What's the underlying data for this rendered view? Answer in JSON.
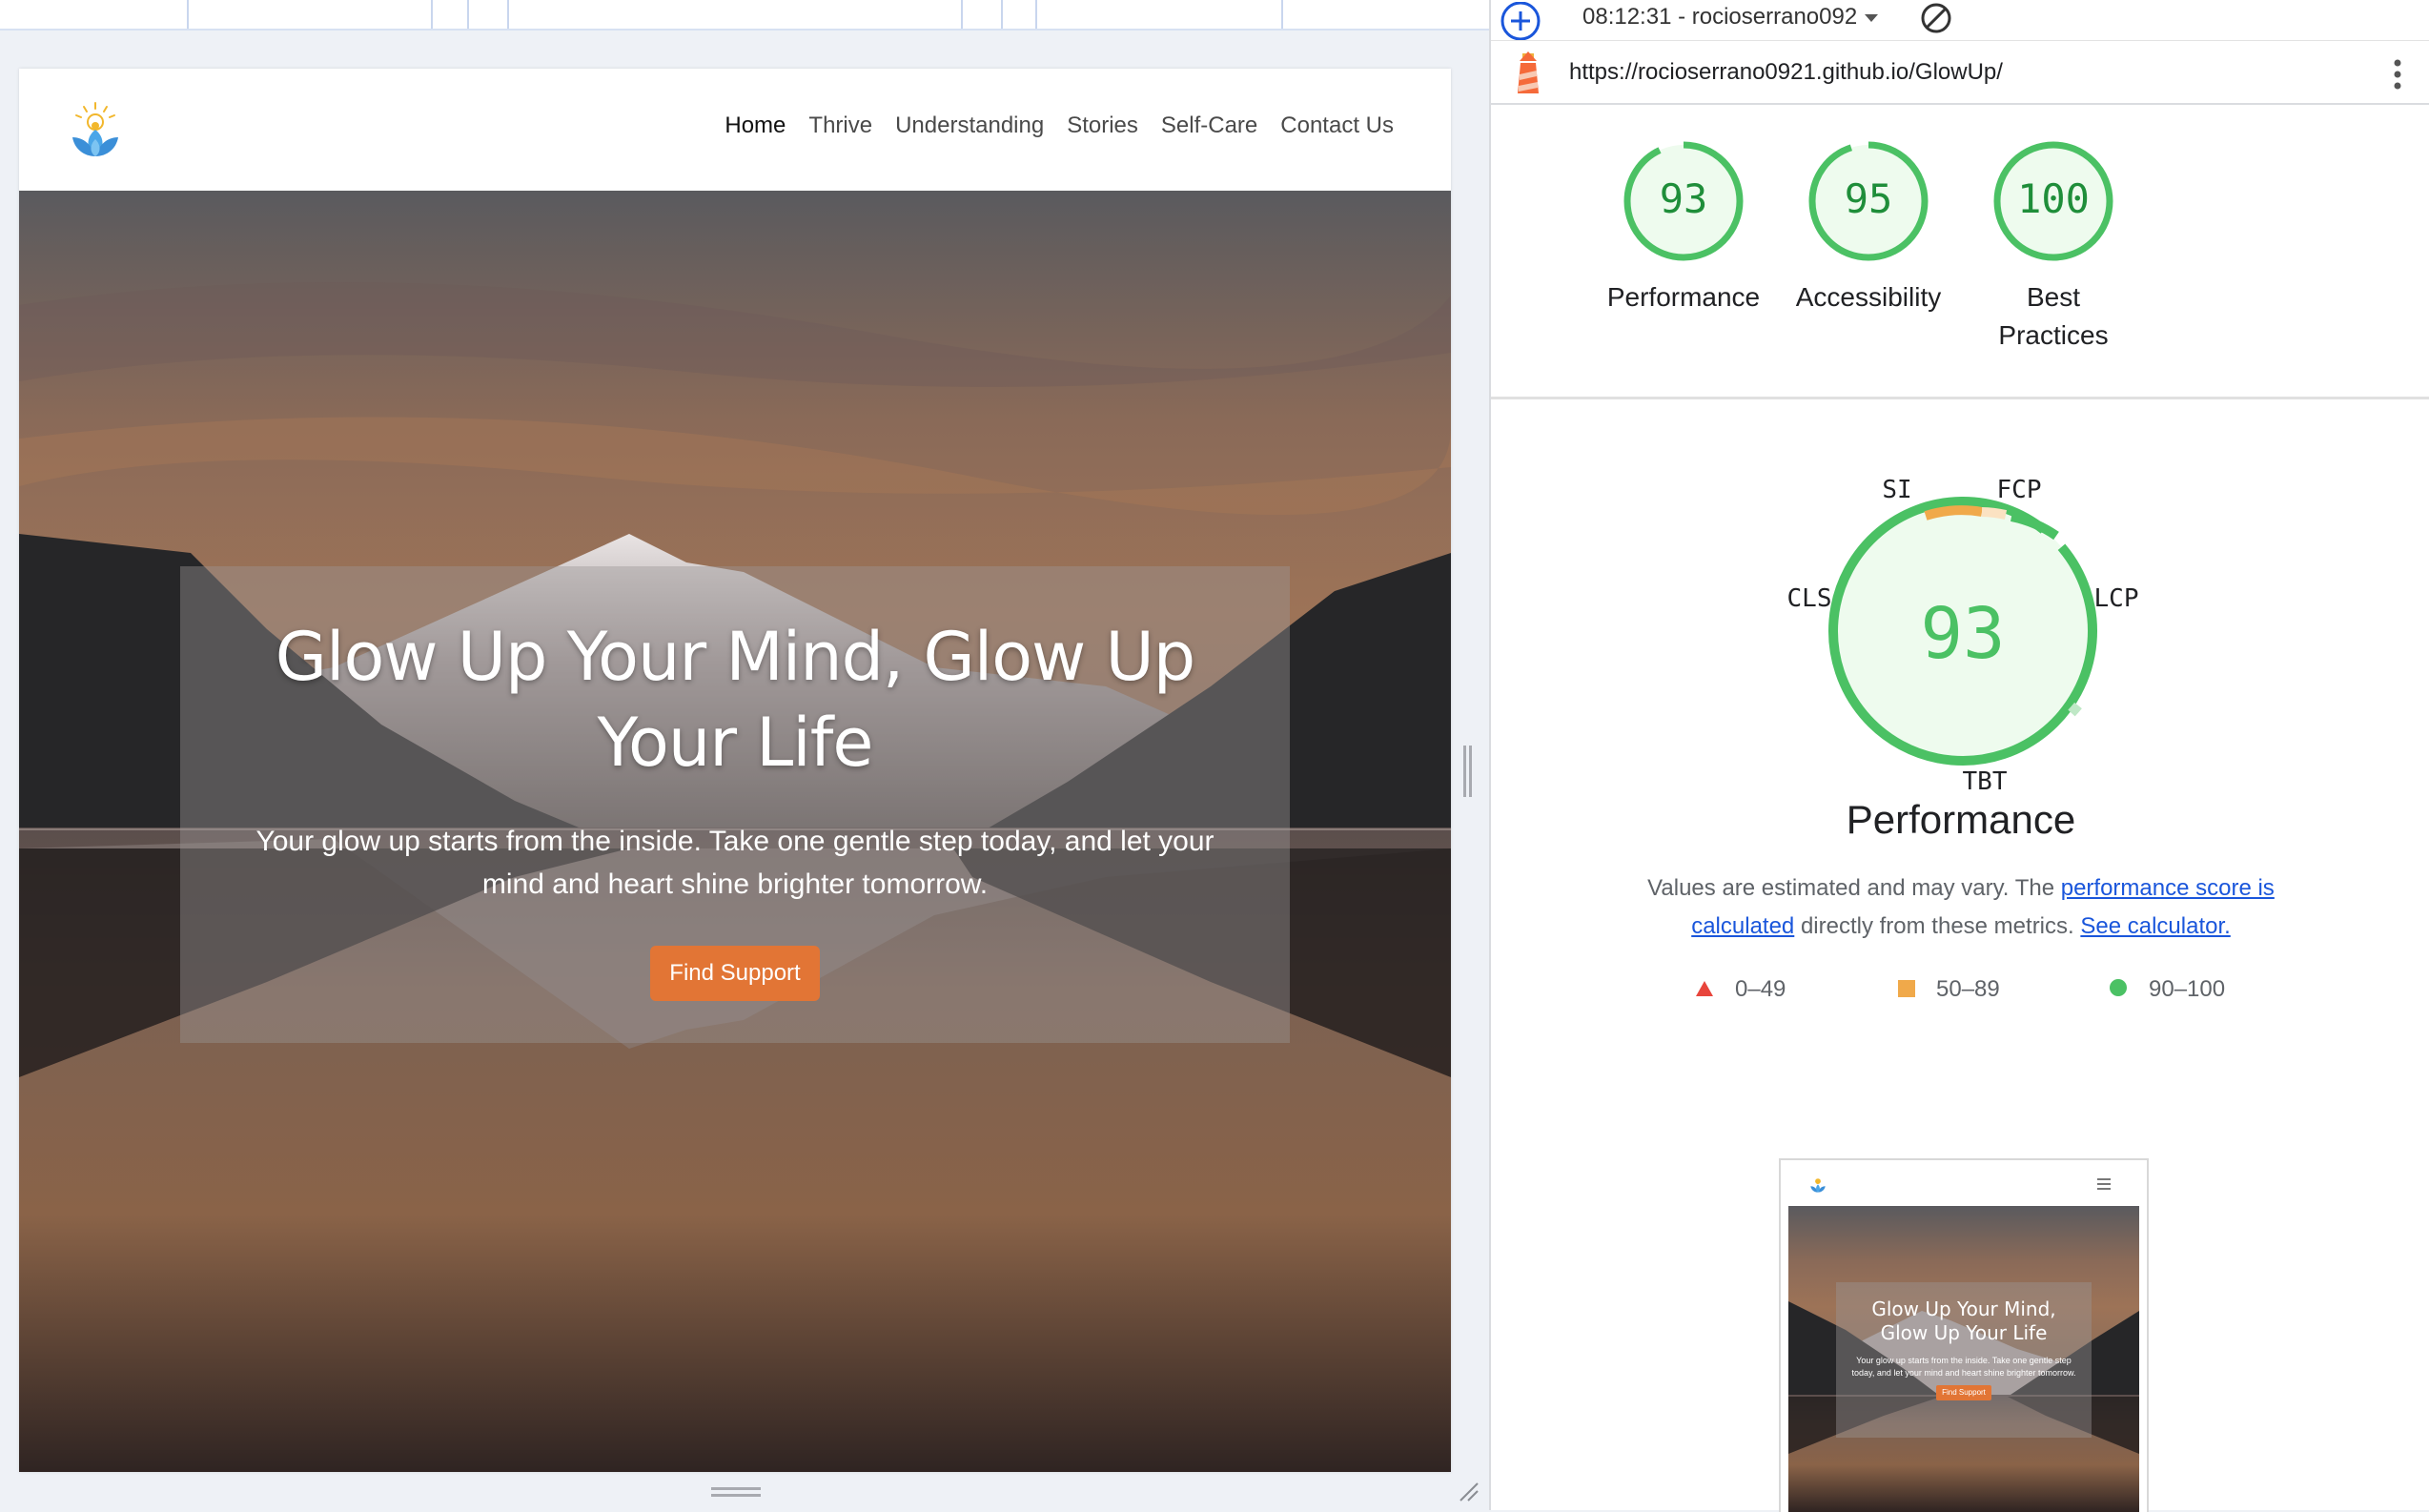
{
  "site": {
    "nav": {
      "items": [
        {
          "label": "Home",
          "active": true
        },
        {
          "label": "Thrive"
        },
        {
          "label": "Understanding"
        },
        {
          "label": "Stories"
        },
        {
          "label": "Self-Care"
        },
        {
          "label": "Contact Us"
        }
      ]
    },
    "hero": {
      "title": "Glow Up Your Mind, Glow Up Your Life",
      "subtitle": "Your glow up starts from the inside. Take one gentle step today, and let your mind and heart shine brighter tomorrow.",
      "cta_label": "Find Support",
      "cta_color": "#e27535"
    }
  },
  "lighthouse": {
    "report_select": "08:12:31 - rocioserrano092",
    "url": "https://rocioserrano0921.github.io/GlowUp/",
    "scores": [
      {
        "label": "Performance",
        "value": "93"
      },
      {
        "label": "Accessibility",
        "value": "95"
      },
      {
        "label": "Best Practices",
        "value": "100"
      }
    ],
    "performance": {
      "score": "93",
      "title": "Performance",
      "metrics": [
        "SI",
        "FCP",
        "LCP",
        "TBT",
        "CLS"
      ],
      "desc_prefix": "Values are estimated and may vary. The ",
      "desc_link1": "performance score is calculated",
      "desc_middle": " directly from these metrics. ",
      "desc_link2": "See calculator.",
      "legend": [
        {
          "range": "0–49",
          "shape": "triangle",
          "color": "#e8453c"
        },
        {
          "range": "50–89",
          "shape": "square",
          "color": "#f0a94a"
        },
        {
          "range": "90–100",
          "shape": "circle",
          "color": "#4bc164"
        }
      ]
    },
    "thumbnail": {
      "title": "Glow Up Your Mind, Glow Up Your Life",
      "subtitle": "Your glow up starts from the inside. Take one gentle step today, and let your mind and heart shine brighter tomorrow.",
      "cta_label": "Find Support"
    },
    "colors": {
      "pass": "#4bc164",
      "pass_bg": "#eefbee",
      "pass_text": "#1f8e3a",
      "average": "#f0a94a",
      "fail": "#e8453c"
    }
  }
}
